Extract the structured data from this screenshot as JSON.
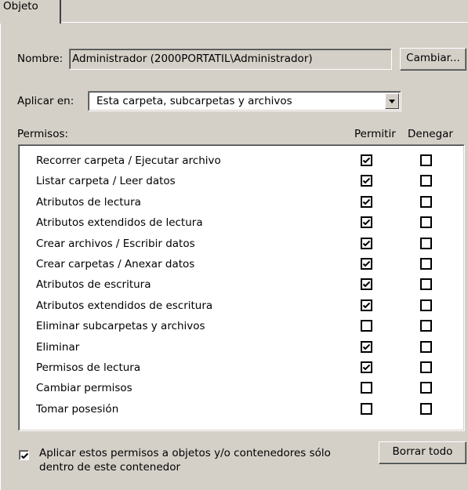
{
  "tab": {
    "label": "Objeto"
  },
  "name": {
    "label": "Nombre:",
    "value": "Administrador (2000PORTATIL\\Administrador)",
    "change_button": "Cambiar..."
  },
  "apply": {
    "label": "Aplicar en:",
    "value": "Esta carpeta, subcarpetas y archivos"
  },
  "permissions": {
    "label": "Permisos:",
    "allow_header": "Permitir",
    "deny_header": "Denegar",
    "items": [
      {
        "name": "Recorrer carpeta / Ejecutar archivo",
        "allow": true,
        "deny": false
      },
      {
        "name": "Listar carpeta / Leer datos",
        "allow": true,
        "deny": false
      },
      {
        "name": "Atributos de lectura",
        "allow": true,
        "deny": false
      },
      {
        "name": "Atributos extendidos de lectura",
        "allow": true,
        "deny": false
      },
      {
        "name": "Crear archivos / Escribir datos",
        "allow": true,
        "deny": false
      },
      {
        "name": "Crear carpetas / Anexar datos",
        "allow": true,
        "deny": false
      },
      {
        "name": "Atributos de escritura",
        "allow": true,
        "deny": false
      },
      {
        "name": "Atributos extendidos de escritura",
        "allow": true,
        "deny": false
      },
      {
        "name": "Eliminar subcarpetas y archivos",
        "allow": false,
        "deny": false
      },
      {
        "name": "Eliminar",
        "allow": true,
        "deny": false
      },
      {
        "name": "Permisos de lectura",
        "allow": true,
        "deny": false
      },
      {
        "name": "Cambiar permisos",
        "allow": false,
        "deny": false
      },
      {
        "name": "Tomar posesión",
        "allow": false,
        "deny": false
      }
    ]
  },
  "apply_only_container": {
    "label": "Aplicar estos permisos a objetos y/o contenedores sólo dentro de este contenedor",
    "checked": true
  },
  "clear_all_button": "Borrar todo"
}
